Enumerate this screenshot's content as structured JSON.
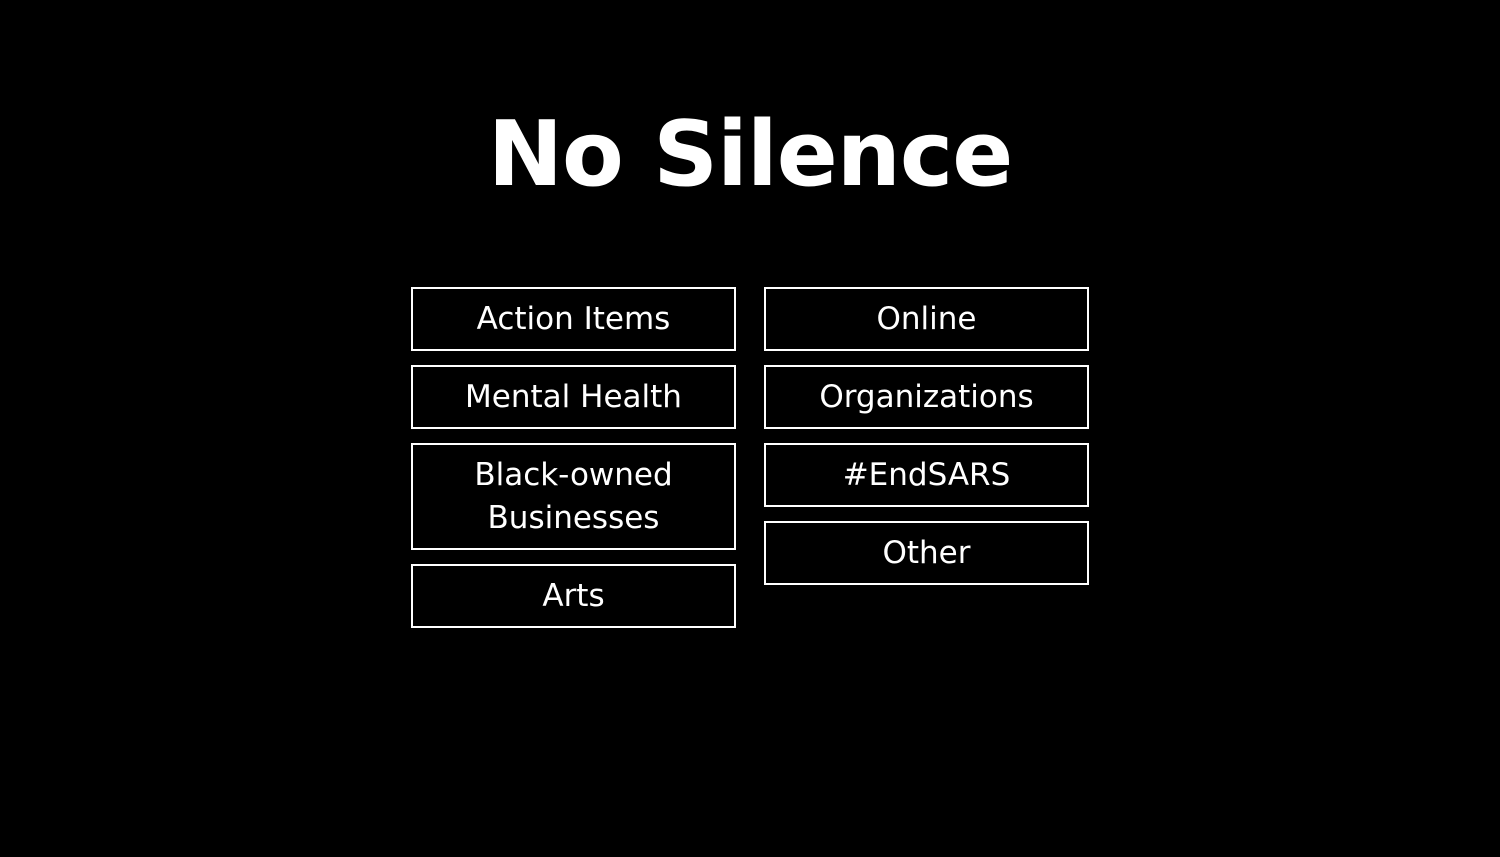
{
  "header": {
    "title": "No Silence"
  },
  "categories": {
    "left": [
      {
        "label": "Action Items"
      },
      {
        "label": "Mental Health"
      },
      {
        "label": "Black-owned Businesses"
      },
      {
        "label": "Arts"
      }
    ],
    "right": [
      {
        "label": "Online"
      },
      {
        "label": "Organizations"
      },
      {
        "label": "#EndSARS"
      },
      {
        "label": "Other"
      }
    ]
  },
  "colors": {
    "background": "#000000",
    "foreground": "#ffffff"
  }
}
